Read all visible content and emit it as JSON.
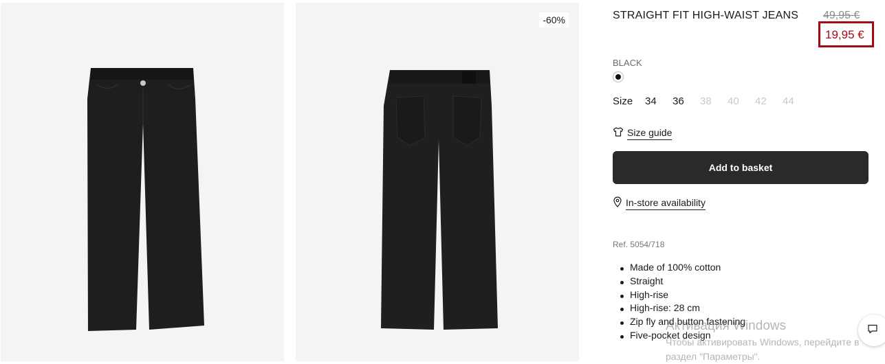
{
  "product": {
    "title": "STRAIGHT FIT HIGH-WAIST JEANS",
    "old_price": "49,95 €",
    "sale_price": "19,95 €",
    "discount_badge": "-60%",
    "color_name": "BLACK",
    "color_hex": "#111111",
    "size_label": "Size",
    "sizes": [
      {
        "label": "34",
        "available": true
      },
      {
        "label": "36",
        "available": true
      },
      {
        "label": "38",
        "available": false
      },
      {
        "label": "40",
        "available": false
      },
      {
        "label": "42",
        "available": false
      },
      {
        "label": "44",
        "available": false
      }
    ],
    "size_guide": "Size guide",
    "add_to_basket": "Add to basket",
    "availability": "In-store availability",
    "ref": "Ref. 5054/718",
    "features": [
      "Made of 100% cotton",
      "Straight",
      "High-rise",
      "High-rise: 28 cm",
      "Zip fly and button fastening",
      "Five-pocket design"
    ]
  },
  "images": [
    {
      "name": "jeans-front-photo",
      "alt": "Black jeans front view"
    },
    {
      "name": "jeans-back-photo",
      "alt": "Black jeans back view"
    }
  ],
  "icons": {
    "size_guide": "tshirt-icon",
    "availability": "location-pin-icon",
    "chat": "chat-icon"
  },
  "watermark": {
    "title": "Активация Windows",
    "line1": "Чтобы активировать Windows, перейдите в",
    "line2": "раздел \"Параметры\"."
  },
  "colors": {
    "sale_red": "#a30a14",
    "button_dark": "#2a2a2a"
  }
}
